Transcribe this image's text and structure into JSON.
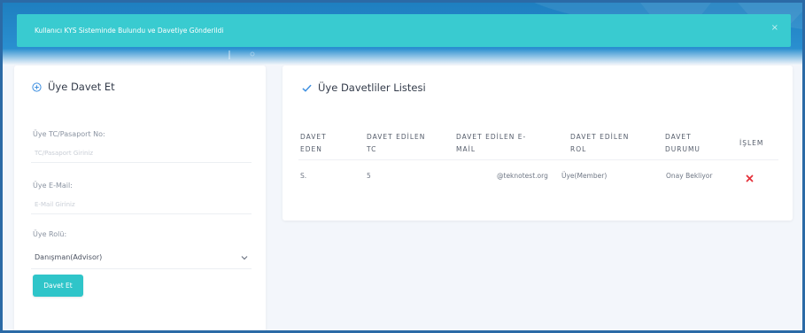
{
  "alert": {
    "message": "Kullanıcı KYS Sisteminde Bulundu ve Davetiye Gönderildi",
    "close_icon": "×"
  },
  "invite_form": {
    "title": "Üye Davet Et",
    "tc_label": "Üye TC/Pasaport No:",
    "tc_placeholder": "TC/Pasaport Giriniz",
    "email_label": "Üye E-Mail:",
    "email_placeholder": "E-Mail Giriniz",
    "role_label": "Üye Rolü:",
    "role_selected": "Danışman(Advisor)",
    "submit_label": "Davet Et"
  },
  "invite_list": {
    "title": "Üye Davetliler Listesi",
    "columns": [
      "DAVET\nEDEN",
      "DAVET EDİLEN\nTC",
      "DAVET EDİLEN E-\nMAİL",
      "DAVET EDİLEN\nROL",
      "DAVET\nDURUMU",
      "İŞLEM"
    ],
    "rows": [
      {
        "inviter": "S.",
        "tc": "5",
        "email": "@teknotest.org",
        "role": "Üye(Member)",
        "status": "Onay Bekliyor"
      }
    ]
  },
  "colors": {
    "accent": "#39cbd0",
    "header_blue": "#1e7fc0",
    "delete": "#e5323b",
    "check": "#3d8fe0"
  }
}
